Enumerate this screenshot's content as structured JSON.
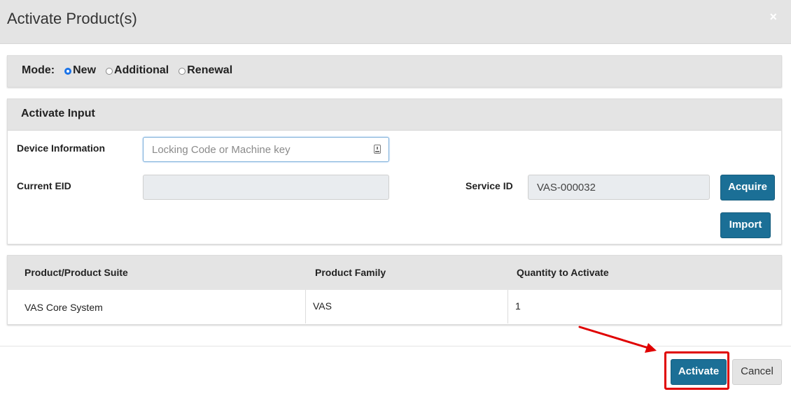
{
  "modal": {
    "title": "Activate Product(s)",
    "close_symbol": "×"
  },
  "mode": {
    "label": "Mode:",
    "options": [
      {
        "label": "New",
        "checked": true
      },
      {
        "label": "Additional",
        "checked": false
      },
      {
        "label": "Renewal",
        "checked": false
      }
    ]
  },
  "activate_input": {
    "heading": "Activate Input",
    "device_information": {
      "label": "Device Information",
      "placeholder": "Locking Code or Machine key",
      "value": ""
    },
    "current_eid": {
      "label": "Current EID",
      "value": ""
    },
    "service_id": {
      "label": "Service ID",
      "value": "VAS-000032"
    },
    "acquire_label": "Acquire",
    "import_label": "Import"
  },
  "table": {
    "headers": [
      "Product/Product Suite",
      "Product Family",
      "Quantity to Activate"
    ],
    "rows": [
      [
        "VAS Core System",
        "VAS",
        "1"
      ]
    ]
  },
  "footer": {
    "activate_label": "Activate",
    "cancel_label": "Cancel"
  },
  "colors": {
    "primary_button": "#1b6f96",
    "highlight": "#e00000",
    "header_bg": "#e4e4e4"
  }
}
